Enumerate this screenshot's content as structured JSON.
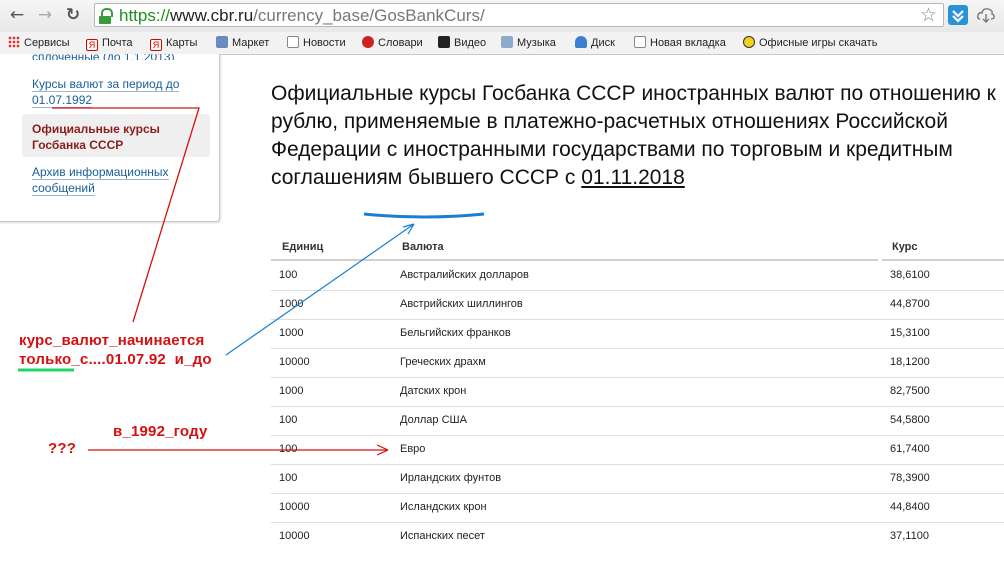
{
  "browser": {
    "url_scheme": "https://",
    "url_host": "www.cbr.ru",
    "url_path": "/currency_base/GosBankCurs/",
    "back": "←",
    "forward": "→",
    "reload": "↻",
    "star": "☆"
  },
  "bookmarks": [
    {
      "label": "Сервисы",
      "icon": "apps-icon"
    },
    {
      "label": "Почта",
      "icon": "yandex-icon"
    },
    {
      "label": "Карты",
      "icon": "yandex-icon"
    },
    {
      "label": "Маркет",
      "icon": "page-icon"
    },
    {
      "label": "Новости",
      "icon": "page-icon"
    },
    {
      "label": "Словари",
      "icon": "dictionary-icon"
    },
    {
      "label": "Видео",
      "icon": "video-icon"
    },
    {
      "label": "Музыка",
      "icon": "music-icon"
    },
    {
      "label": "Диск",
      "icon": "disk-icon"
    },
    {
      "label": "Новая вкладка",
      "icon": "page-icon"
    },
    {
      "label": "Офисные игры скачать",
      "icon": "game-icon"
    }
  ],
  "sidebar": {
    "cut_item": "сплоченные (до 1.1.2013)",
    "items": [
      {
        "label": "Курсы валют за период до 01.07.1992"
      },
      {
        "label": "Официальные курсы Госбанка СССР",
        "active": true
      },
      {
        "label": "Архив информационных сообщений"
      }
    ]
  },
  "main": {
    "heading": "Официальные курсы Госбанка СССР иностранных валют по отношению к рублю, применяемые в платежно-расчетных отношениях Российской Федерации с иностранными государствами по торговым и кредитным соглашениям бывшего СССР с",
    "date": "01.11.2018",
    "table": {
      "headers": [
        "Единиц",
        "Валюта",
        "Курс"
      ],
      "rows": [
        [
          "100",
          "Австралийских долларов",
          "38,6100"
        ],
        [
          "1000",
          "Австрийских шиллингов",
          "44,8700"
        ],
        [
          "1000",
          "Бельгийских франков",
          "15,3100"
        ],
        [
          "10000",
          "Греческих драхм",
          "18,1200"
        ],
        [
          "1000",
          "Датских крон",
          "82,7500"
        ],
        [
          "100",
          "Доллар США",
          "54,5800"
        ],
        [
          "100",
          "Евро",
          "61,7400"
        ],
        [
          "100",
          "Ирландских фунтов",
          "78,3900"
        ],
        [
          "10000",
          "Исландских крон",
          "44,8400"
        ],
        [
          "10000",
          "Испанских песет",
          "37,1100"
        ]
      ]
    }
  },
  "annotations": {
    "line1": "курс_валют_начинается",
    "line2": "только_с....01.07.92  и_до",
    "year": "в_1992_году",
    "question": "???"
  },
  "colors": {
    "annotation_red": "#d61010",
    "arrow_blue": "#1a7fd4",
    "underline_green": "#22d46a",
    "link_blue": "#1a5d9a",
    "active_red": "#8c1d1d"
  }
}
